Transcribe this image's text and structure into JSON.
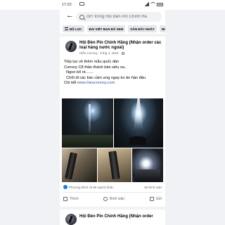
{
  "status_bar": {
    "time": "17:22"
  },
  "search": {
    "query": "c8+ trong Hội Đèn Pin Chính Hã"
  },
  "filters": [
    {
      "label": "BỘ LỌC"
    },
    {
      "label": "BÀI VIẾT BẠN ĐÃ XEM"
    },
    {
      "label": "GẦN ĐÂY NHẤT"
    },
    {
      "label": "NG"
    }
  ],
  "post": {
    "page_name": "Hội Đèn Pin Chính Hãng (Nhận order các loại hàng nước ngoài)",
    "author": "Hiếu Convoy",
    "date": "8 thg 4, 2022",
    "body_lines": [
      "Tiếp tục về thêm mẫu quốc dân",
      "Convoy C8 thần thánh bản siêu xa..",
      "  Ngon bổ rẻ.......",
      "  Chốt đi các bác cầm ưng ngay ko ân hận đâu"
    ],
    "detail_label": "Chi tiết",
    "link": "www.hieuconvoy.com",
    "reactions_text": "Phương Đình và 96 người khác",
    "comments_text": "65 bình luận",
    "actions": [
      {
        "label": "Thích",
        "icon": "like-icon"
      },
      {
        "label": "Bình luận",
        "icon": "comment-icon"
      },
      {
        "label": "Gửi",
        "icon": "share-icon"
      }
    ]
  },
  "post2": {
    "page_name": "Hội Đèn Pin Chính Hãng (Nhận order"
  }
}
